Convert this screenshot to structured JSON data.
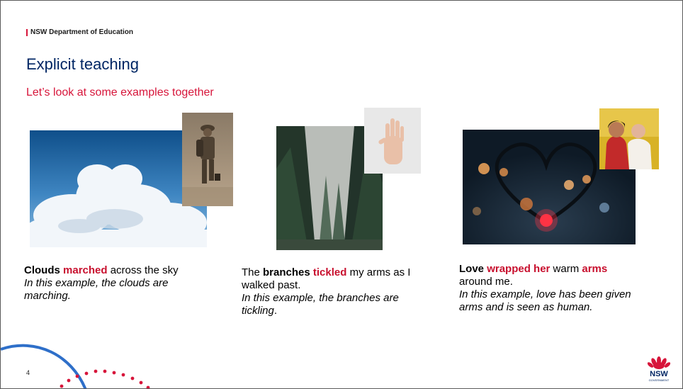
{
  "header": {
    "department": "NSW Department of Education"
  },
  "title": "Explicit teaching",
  "subtitle": "Let’s look at some examples together",
  "examples": [
    {
      "lead": "Clouds",
      "highlight": "marched",
      "rest": " across the sky",
      "explanation": "In this example, the clouds are marching."
    },
    {
      "pre": "The ",
      "bold": "branches",
      "highlight": "tickled",
      "rest": " my arms as I walked past.",
      "explanation_start": "In this example, the branches are tickling",
      "explanation_end": "."
    },
    {
      "lead": "Love",
      "highlight": "wrapped her",
      "mid": " warm ",
      "highlight2": "arms",
      "rest": " around me.",
      "explanation": "In this example, love has been given arms and is seen as human."
    }
  ],
  "footer": {
    "page_number": "4"
  },
  "logo": {
    "text": "NSW",
    "subtext": "GOVERNMENT"
  },
  "colors": {
    "navy": "#002664",
    "red": "#d7153a",
    "blue": "#2e6fc9"
  }
}
